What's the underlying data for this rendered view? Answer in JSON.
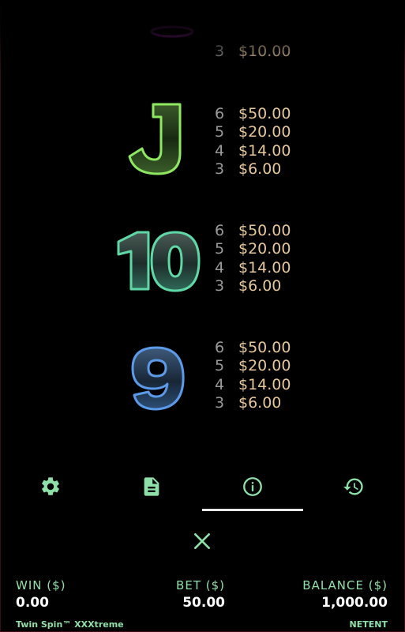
{
  "paytable": {
    "partial_row": {
      "pays": [
        {
          "count": "3",
          "amount": "$10.00"
        }
      ]
    },
    "rows": [
      {
        "symbol": "J",
        "pays": [
          {
            "count": "6",
            "amount": "$50.00"
          },
          {
            "count": "5",
            "amount": "$20.00"
          },
          {
            "count": "4",
            "amount": "$14.00"
          },
          {
            "count": "3",
            "amount": "$6.00"
          }
        ]
      },
      {
        "symbol": "10",
        "pays": [
          {
            "count": "6",
            "amount": "$50.00"
          },
          {
            "count": "5",
            "amount": "$20.00"
          },
          {
            "count": "4",
            "amount": "$14.00"
          },
          {
            "count": "3",
            "amount": "$6.00"
          }
        ]
      },
      {
        "symbol": "9",
        "pays": [
          {
            "count": "6",
            "amount": "$50.00"
          },
          {
            "count": "5",
            "amount": "$20.00"
          },
          {
            "count": "4",
            "amount": "$14.00"
          },
          {
            "count": "3",
            "amount": "$6.00"
          }
        ]
      }
    ],
    "symbol_colors": {
      "J": "#7ee04a",
      "10": "#4fd0a0",
      "9": "#4a86d8"
    }
  },
  "toolbar": {
    "items": [
      {
        "icon": "gear-icon",
        "active": false
      },
      {
        "icon": "document-icon",
        "active": false
      },
      {
        "icon": "info-icon",
        "active": true
      },
      {
        "icon": "history-icon",
        "active": false
      }
    ],
    "close_icon": "close-icon"
  },
  "footer": {
    "win": {
      "label": "WIN ($)",
      "value": "0.00"
    },
    "bet": {
      "label": "BET ($)",
      "value": "50.00"
    },
    "balance": {
      "label": "BALANCE ($)",
      "value": "1,000.00"
    },
    "game_title": "Twin Spin™ XXXtreme",
    "brand": "NETENT"
  },
  "colors": {
    "accent_green": "#8fe0a8",
    "payout_gold": "#e6c79a",
    "count_grey": "#9a9a9a",
    "background": "#000000"
  }
}
